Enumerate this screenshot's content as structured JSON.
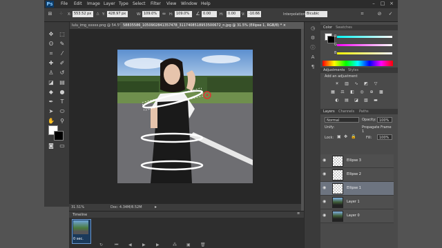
{
  "app": {
    "logo": "Ps"
  },
  "menu": [
    "File",
    "Edit",
    "Image",
    "Layer",
    "Type",
    "Select",
    "Filter",
    "View",
    "Window",
    "Help"
  ],
  "window_controls": [
    "–",
    "□",
    "×"
  ],
  "options": {
    "x_label": "X:",
    "x_value": "553.52 px",
    "y_label": "Y:",
    "y_value": "428.97 px",
    "w_label": "W:",
    "w_value": "109.0%",
    "h_label": "H:",
    "h_value": "109.0%",
    "angle_value": "0.00",
    "h2_label": "H:",
    "h2_value": "0.00",
    "v_label": "V:",
    "v_value": "-10.66",
    "interp_label": "Interpolation:",
    "interp_value": "Bicubic"
  },
  "tabs": [
    {
      "label": "lulu_img_xxxxx.png @ 54.5% ×"
    },
    {
      "label": "58835586_1050902841357478_3117408518953500672_n.jpg @ 31.5% (Ellipse 1, RGB/8) *  ×"
    }
  ],
  "status": {
    "zoom": "31.51%",
    "doc": "Doc: 4.34M/8.52M"
  },
  "timeline": {
    "title": "Timeline",
    "frame_time": "0 sec."
  },
  "color_panel": {
    "tab1": "Color",
    "tab2": "Swatches",
    "r": "R",
    "g": "G",
    "b": "B"
  },
  "adjust_panel": {
    "tab1": "Adjustments",
    "tab2": "Styles",
    "hint": "Add an adjustment"
  },
  "layers_panel": {
    "tab1": "Layers",
    "tab2": "Channels",
    "tab3": "Paths",
    "blend": "Normal",
    "opacity_label": "Opacity:",
    "opacity": "100%",
    "unify": "Unify:",
    "propagate": "Propagate Frame 1",
    "lock": "Lock:",
    "fill_label": "Fill:",
    "fill": "100%",
    "layers": [
      {
        "name": "Ellipse 3",
        "selected": false,
        "type": "ellipse"
      },
      {
        "name": "Ellipse 2",
        "selected": false,
        "type": "ellipse"
      },
      {
        "name": "Ellipse 1",
        "selected": true,
        "type": "ellipse"
      },
      {
        "name": "Layer 1",
        "selected": false,
        "type": "photo"
      },
      {
        "name": "Layer 0",
        "selected": false,
        "type": "photo"
      }
    ]
  },
  "colors": {
    "accent": "#1473e6",
    "selected_layer": "#6d7480"
  }
}
